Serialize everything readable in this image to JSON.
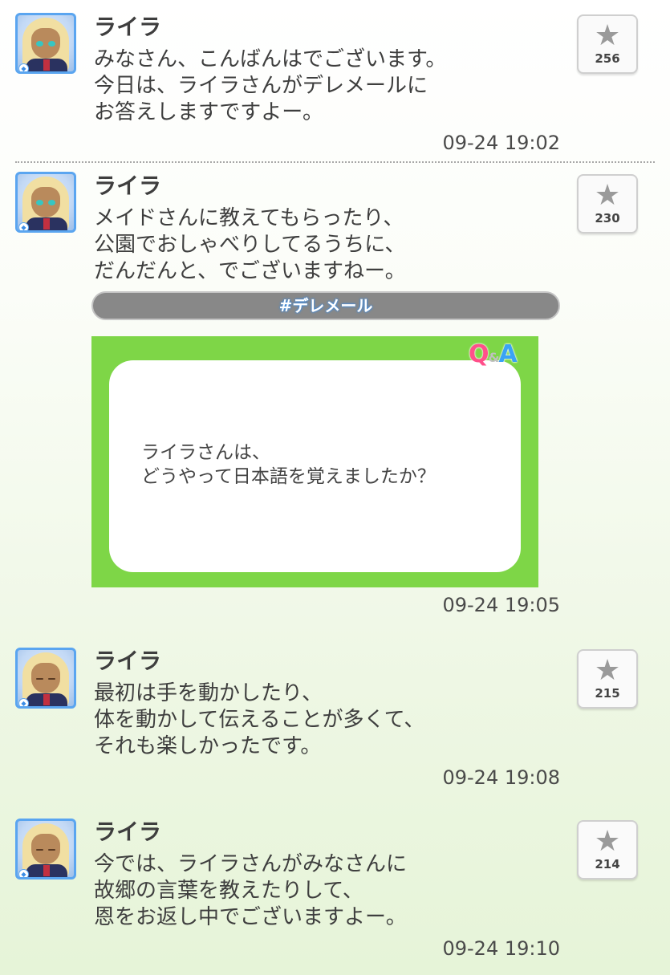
{
  "posts": [
    {
      "name": "ライラ",
      "message": "みなさん、こんばんはでございます。\n今日は、ライラさんがデレメールに\nお答えしますですよー。",
      "time": "09-24 19:02",
      "likes": "256",
      "avatar_eyes": "open"
    },
    {
      "name": "ライラ",
      "message": "メイドさんに教えてもらったり、\n公園でおしゃべりしてるうちに、\nだんだんと、でございますねー。",
      "time": "09-24 19:05",
      "likes": "230",
      "avatar_eyes": "open",
      "hashtag": "#デレメール",
      "qa_card": {
        "logo_q": "Q",
        "logo_amp": "&",
        "logo_a": "A",
        "question": "ライラさんは、\nどうやって日本語を覚えましたか？"
      }
    },
    {
      "name": "ライラ",
      "message": "最初は手を動かしたり、\n体を動かして伝えることが多くて、\nそれも楽しかったです。",
      "time": "09-24 19:08",
      "likes": "215",
      "avatar_eyes": "closed"
    },
    {
      "name": "ライラ",
      "message": "今では、ライラさんがみなさんに\n故郷の言葉を教えたりして、\n恩をお返し中でございますよー。",
      "time": "09-24 19:10",
      "likes": "214",
      "avatar_eyes": "closed"
    }
  ],
  "icons": {
    "like": "star-icon",
    "badge": "diamond-icon"
  },
  "colors": {
    "avatar_border": "#5aa5f0",
    "qa_green": "#7ed647",
    "hashtag_bg": "#888888"
  }
}
